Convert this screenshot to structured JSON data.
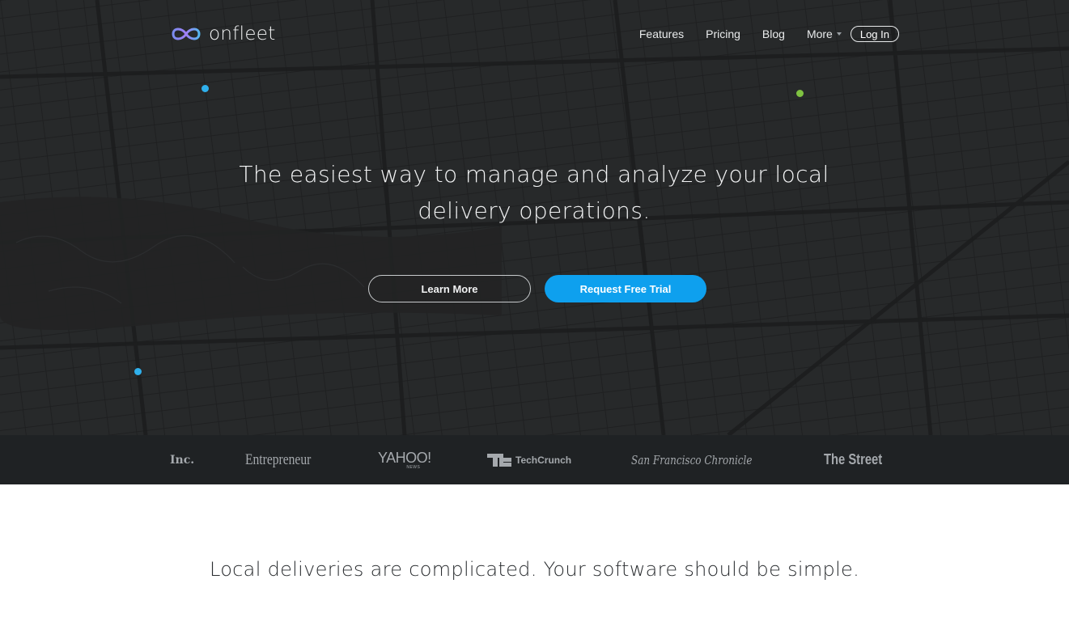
{
  "nav": {
    "logo_text": "onfleet",
    "links": [
      {
        "label": "Features"
      },
      {
        "label": "Pricing"
      },
      {
        "label": "Blog"
      },
      {
        "label": "More"
      }
    ],
    "login_label": "Log In"
  },
  "hero": {
    "headline": "The easiest way to manage and analyze your local delivery operations.",
    "learn_more_label": "Learn More",
    "trial_label": "Request Free Trial"
  },
  "press": {
    "logos": [
      "Inc.",
      "Entrepreneur",
      "YAHOO!",
      "NEWS",
      "TechCrunch",
      "San Francisco Chronicle",
      "The Street"
    ]
  },
  "section": {
    "tagline": "Local deliveries are complicated. Your software should be simple."
  },
  "colors": {
    "hero_bg": "#262829",
    "accent_blue": "#0ea0ee",
    "dot_blue": "#2fb0ec",
    "dot_green": "#7fc241",
    "press_bg": "#1f2224"
  },
  "icons": [
    "onfleet-logo-icon",
    "chevron-down-icon",
    "techcrunch-logo-icon"
  ]
}
